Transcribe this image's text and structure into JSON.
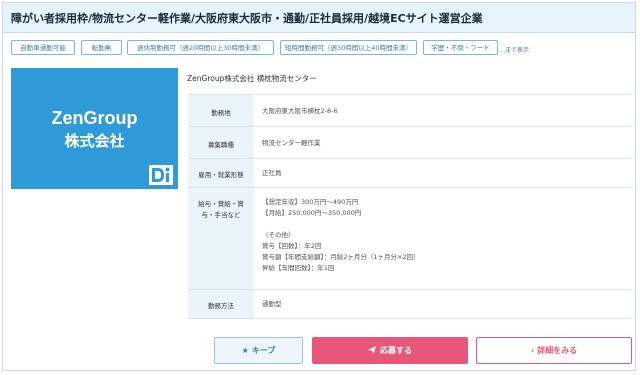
{
  "job": {
    "title": "障がい者採用枠/物流センター軽作業/大阪府東大阪市・通勤/正社員採用/越境ECサイト運営企業",
    "tags": [
      "自動車通勤可能",
      "転勤無",
      "週休制勤務可（週20時間以上30時間未満）",
      "短時間勤務可（週30時間以上40時間未満）",
      "学歴・不問・フード"
    ],
    "tags_more": "…まで表示",
    "logo": {
      "line1": "ZenGroup",
      "line2": "株式会社"
    },
    "company": "ZenGroup株式会社 横枕物流センター",
    "details": [
      {
        "label": "勤務地",
        "lines": [
          "大阪府東大阪市横枕2-8-6"
        ]
      },
      {
        "label": "募集職種",
        "lines": [
          "物流センター軽作業"
        ]
      },
      {
        "label": "雇用・就業形態",
        "lines": [
          "正社員"
        ]
      },
      {
        "label_lines": [
          "給与・賞給・賞",
          "与・手当など"
        ],
        "lines": [
          "【想定年収】300万円～490万円",
          "【月給】250,000円～350,000円",
          "",
          "（その他）",
          "賞与【回数】：年2回",
          "賞与額【年間支給額】：月給2ヶ月分（1ヶ月分×2回）",
          "昇給【年間回数】：年1回"
        ]
      },
      {
        "label": "勤務方法",
        "lines": [
          "通勤型"
        ]
      }
    ],
    "buttons": {
      "keep": "キープ",
      "apply": "応募する",
      "detail": "詳細をみる"
    }
  }
}
